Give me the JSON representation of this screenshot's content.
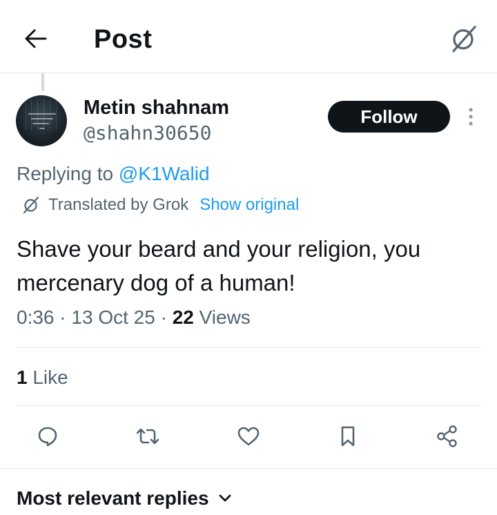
{
  "header": {
    "title": "Post",
    "back_icon": "arrow-left-icon",
    "grok_icon": "grok-icon"
  },
  "post": {
    "author_name": "Metin shahnam",
    "author_handle": "@shahn30650",
    "follow_label": "Follow",
    "replying_prefix": "Replying to",
    "replying_handle": "@K1Walid",
    "translated_label": "Translated by Grok",
    "show_original_label": "Show original",
    "text": "Shave your beard and your religion, you mercenary dog of a human!",
    "time": "0:36",
    "date": "13 Oct 25",
    "views_count": "22",
    "views_label": "Views",
    "likes_count": "1",
    "likes_label": "Like"
  },
  "actions": [
    "reply-icon",
    "repost-icon",
    "like-icon",
    "bookmark-icon",
    "share-icon"
  ],
  "replies": {
    "sort_label": "Most relevant replies"
  },
  "colors": {
    "accent": "#1d9bf0",
    "text": "#0f1419",
    "secondary": "#536471",
    "divider": "#e5e7ea"
  }
}
